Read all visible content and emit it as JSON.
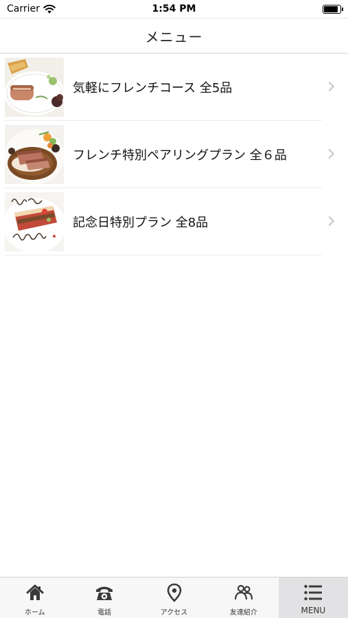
{
  "status_bar": {
    "carrier": "Carrier",
    "time": "1:54 PM",
    "battery_level": 0.85
  },
  "nav": {
    "title": "メニュー"
  },
  "menu": {
    "items": [
      {
        "label": "気軽にフレンチコース 全5品",
        "thumbnail_icon": "foie-gras-plate-photo"
      },
      {
        "label": "フレンチ特別ペアリングプラン 全６品",
        "thumbnail_icon": "duck-sauce-plate-photo"
      },
      {
        "label": "記念日特別プラン 全8品",
        "thumbnail_icon": "happy-birthday-dessert-photo"
      }
    ]
  },
  "tab_bar": {
    "tabs": [
      {
        "label": "ホーム",
        "icon": "home-icon"
      },
      {
        "label": "電話",
        "icon": "phone-icon"
      },
      {
        "label": "アクセス",
        "icon": "map-pin-icon"
      },
      {
        "label": "友達紹介",
        "icon": "friends-icon"
      },
      {
        "label": "MENU",
        "icon": "menu-list-icon"
      }
    ],
    "active_index": 4
  },
  "colors": {
    "separator": "#ececec",
    "chevron": "#c4c4c8",
    "tab_bar_bg": "#f7f7f7",
    "active_tab_bg": "#e2e2e4",
    "icon": "#3a3a3a"
  }
}
